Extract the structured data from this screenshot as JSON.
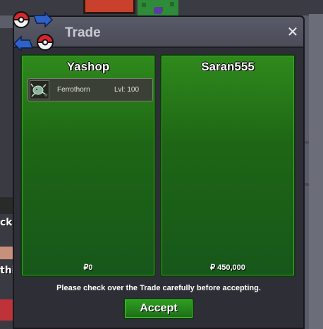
{
  "window": {
    "title": "Trade",
    "close_glyph": "✕"
  },
  "left_panel": {
    "player_name": "Yashop",
    "money": "₽0",
    "items": [
      {
        "name": "Ferrothorn",
        "level": "Lvl: 100",
        "icon": "ferrothorn-sprite-icon"
      }
    ]
  },
  "right_panel": {
    "player_name": "Saran555",
    "money": "₽ 450,000",
    "items": []
  },
  "footer": {
    "notice": "Please check over the Trade carefully before accepting.",
    "accept_label": "Accept"
  },
  "background_fragments": {
    "fragment_1": "ck",
    "fragment_2": "thi"
  },
  "colors": {
    "panel_green": "#1e6615",
    "accept_green": "#2f9e22",
    "window_dark": "#2e2f36"
  }
}
